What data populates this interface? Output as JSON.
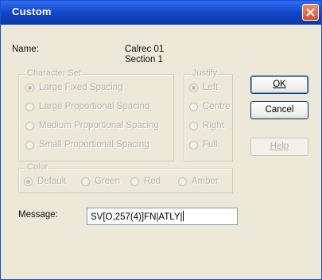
{
  "window": {
    "title": "Custom"
  },
  "name": {
    "label": "Name:",
    "value_line1": "Calrec 01",
    "value_line2": "Section 1"
  },
  "charset": {
    "label": "Character Set",
    "options": [
      {
        "label": "Large Fixed Spacing",
        "selected": true
      },
      {
        "label": "Large Proportional Spacing",
        "selected": false
      },
      {
        "label": "Medium Proportional Spacing",
        "selected": false
      },
      {
        "label": "Small Proportional Spacing",
        "selected": false
      }
    ]
  },
  "justify": {
    "label": "Justify",
    "options": [
      {
        "label": "Left",
        "selected": true
      },
      {
        "label": "Centre",
        "selected": false
      },
      {
        "label": "Right",
        "selected": false
      },
      {
        "label": "Full",
        "selected": false
      }
    ]
  },
  "color": {
    "label": "Color",
    "options": [
      {
        "label": "Default",
        "selected": true
      },
      {
        "label": "Green",
        "selected": false
      },
      {
        "label": "Red",
        "selected": false
      },
      {
        "label": "Amber",
        "selected": false
      }
    ]
  },
  "buttons": {
    "ok": "OK",
    "cancel": "Cancel",
    "help": "Help"
  },
  "message": {
    "label": "Message:",
    "value": "SV[O,257(4)]FN|ATLY|"
  },
  "colors": {
    "titlebar": "#1142c6",
    "dialog_bg": "#ece9d8",
    "close": "#d9532a"
  }
}
